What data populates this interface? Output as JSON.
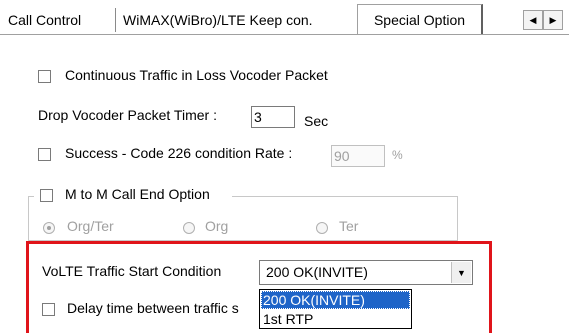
{
  "tabs": [
    {
      "label": "Call Control"
    },
    {
      "label": "WiMAX(WiBro)/LTE Keep con."
    },
    {
      "label": "Special Option"
    }
  ],
  "tab_scroll": {
    "left_icon": "arrow-left-icon",
    "right_icon": "arrow-right-icon"
  },
  "options": {
    "continuous_traffic": {
      "label": "Continuous Traffic in Loss Vocoder Packet",
      "checked": false
    },
    "drop_timer": {
      "label": "Drop Vocoder Packet Timer :",
      "value": "3",
      "unit": "Sec"
    },
    "success_code": {
      "label": "Success - Code 226 condition Rate :",
      "value": "90",
      "unit": "%",
      "checked": false
    },
    "m2m": {
      "label": "M to M Call End Option",
      "checked": false,
      "radios": [
        {
          "label": "Org/Ter",
          "selected": true
        },
        {
          "label": "Org",
          "selected": false
        },
        {
          "label": "Ter",
          "selected": false
        }
      ]
    },
    "volte": {
      "label": "VoLTE Traffic Start Condition",
      "selected": "200 OK(INVITE)",
      "dropdown_options": [
        "200 OK(INVITE)",
        "1st RTP"
      ]
    },
    "delay": {
      "label": "Delay time between traffic s",
      "checked": false
    }
  },
  "colors": {
    "highlight_border": "#e0141a",
    "selection": "#1e64c8"
  }
}
